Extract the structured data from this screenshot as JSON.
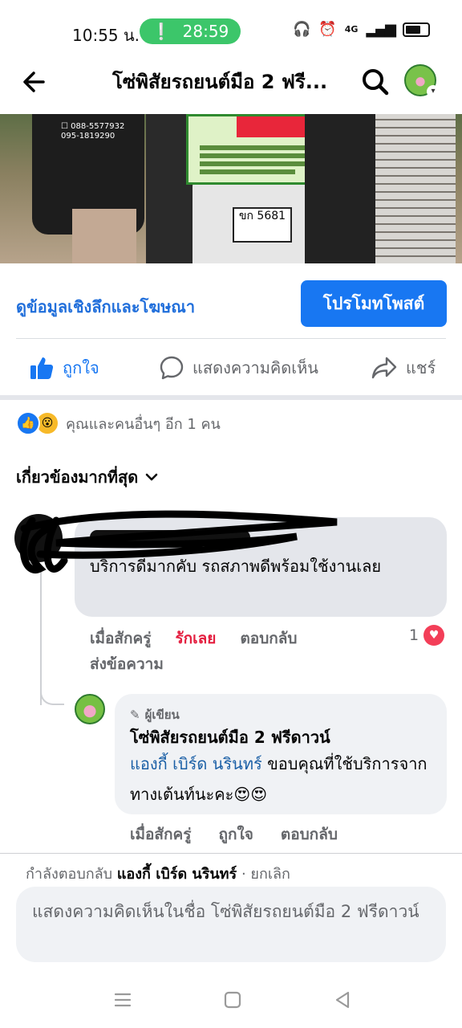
{
  "status_bar": {
    "time": "10:55 น.",
    "timer": "28:59",
    "network": "4G"
  },
  "header": {
    "title": "โซ่พิสัยรถยนต์มือ 2 ฟรี..."
  },
  "photo": {
    "plate": "ขก 5681"
  },
  "post_actions": {
    "insights": "ดูข้อมูลเชิงลึกและโฆษณา",
    "promote": "โปรโมทโพสต์",
    "like": "ถูกใจ",
    "comment": "แสดงความคิดเห็น",
    "share": "แชร์"
  },
  "reactions": {
    "summary": "คุณและคนอื่นๆ อีก 1 คน"
  },
  "filter": {
    "label": "เกี่ยวข้องมากที่สุด"
  },
  "comments": [
    {
      "text": "บริการดีมากคับ รถสภาพดีพร้อมใช้งานเลย",
      "time": "เมื่อสักครู่",
      "reaction_label": "รักเลย",
      "reply": "ตอบกลับ",
      "message": "ส่งข้อความ",
      "reaction_count": "1"
    }
  ],
  "reply": {
    "badge": "ผู้เขียน",
    "author": "โซ่พิสัยรถยนต์มือ 2 ฟรีดาวน์",
    "mention": "แองกี้ เบิร์ด นรินทร์",
    "text": " ขอบคุณที่ใช้บริการจากทางเต้นท์นะคะ😍😍",
    "time": "เมื่อสักครู่",
    "like": "ถูกใจ",
    "reply": "ตอบกลับ"
  },
  "composer": {
    "replying_prefix": "กำลังตอบกลับ ",
    "replying_name": "แองกี้ เบิร์ด นรินทร์",
    "cancel": "ยกเลิก",
    "placeholder": "แสดงความคิดเห็นในชื่อ โซ่พิสัยรถยนต์มือ 2 ฟรีดาวน์"
  }
}
